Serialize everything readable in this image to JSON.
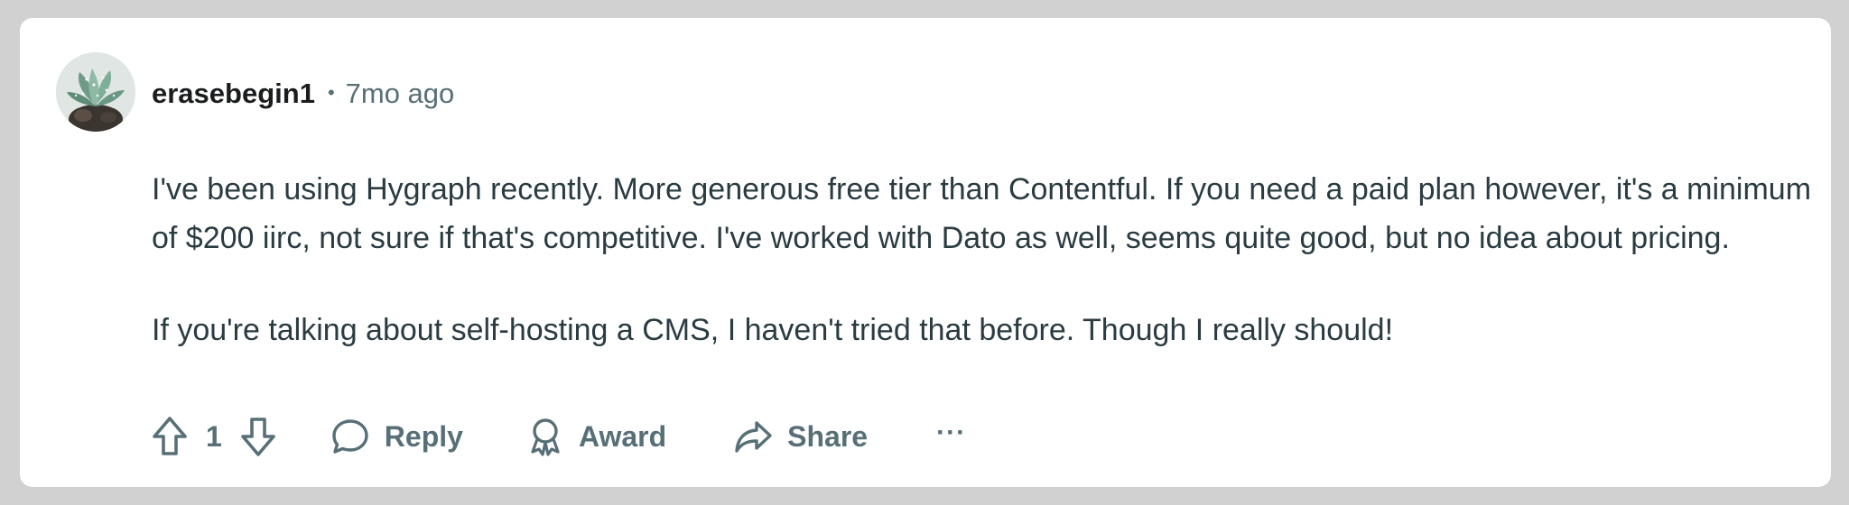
{
  "comment": {
    "username": "erasebegin1",
    "separator": "•",
    "timestamp": "7mo ago",
    "avatar": "succulent-avatar-icon",
    "paragraphs": [
      "I've been using Hygraph recently. More generous free tier than Contentful. If you need a paid plan however, it's a minimum of $200 iirc, not sure if that's competitive. I've worked with Dato as well, seems quite good, but no idea about pricing.",
      "If you're talking about self-hosting a CMS, I haven't tried that before. Though I really should!"
    ]
  },
  "actions": {
    "upvote_icon": "upvote-icon",
    "vote_count": "1",
    "downvote_icon": "downvote-icon",
    "reply_icon": "comment-bubble-icon",
    "reply_label": "Reply",
    "award_icon": "award-icon",
    "award_label": "Award",
    "share_icon": "share-icon",
    "share_label": "Share",
    "more_label": "···"
  },
  "colors": {
    "page_background": "#d1d1d1",
    "card_background": "#ffffff",
    "text_primary": "#1a1c1e",
    "text_body": "#2a3c42",
    "text_secondary": "#576f76"
  }
}
